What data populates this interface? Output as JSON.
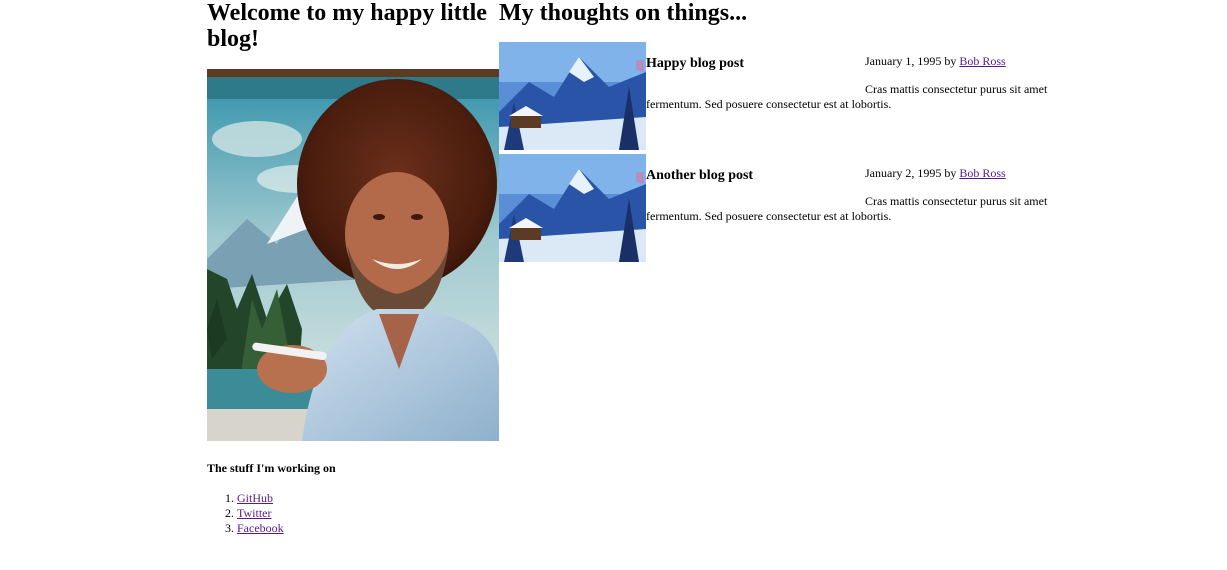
{
  "left": {
    "heading": "Welcome to my happy little blog!",
    "section_title": "The stuff I'm working on",
    "links": [
      {
        "label": "GitHub"
      },
      {
        "label": "Twitter"
      },
      {
        "label": "Facebook"
      }
    ]
  },
  "right": {
    "heading": "My thoughts on things...",
    "posts": [
      {
        "title": "Happy blog post",
        "date": "January 1, 1995",
        "by": "by",
        "author": "Bob Ross",
        "body": "Cras mattis consectetur purus sit amet fermentum. Sed posuere consectetur est at lobortis."
      },
      {
        "title": "Another blog post",
        "date": "January 2, 1995",
        "by": "by",
        "author": "Bob Ross",
        "body": "Cras mattis consectetur purus sit amet fermentum. Sed posuere consectetur est at lobortis."
      }
    ]
  },
  "colors": {
    "link": "#551a8b",
    "text": "#000000",
    "background": "#ffffff"
  }
}
